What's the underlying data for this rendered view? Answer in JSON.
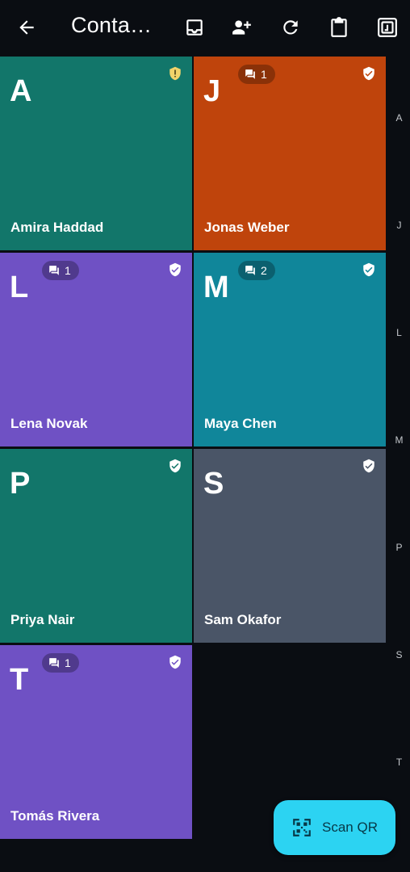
{
  "appbar": {
    "title": "Conta…",
    "actions": [
      "back-arrow-icon",
      "inbox-icon",
      "add-contact-icon",
      "refresh-icon",
      "clipboard-icon",
      "qr-frame-icon"
    ]
  },
  "contacts": [
    {
      "initial": "A",
      "name": "Amira Haddad",
      "color": "#12766a",
      "verified": "warning",
      "badge": null
    },
    {
      "initial": "J",
      "name": "Jonas Weber",
      "color": "#bf440c",
      "verified": "verified",
      "badge": "1"
    },
    {
      "initial": "L",
      "name": "Lena Novak",
      "color": "#6f51c4",
      "verified": "verified",
      "badge": "1"
    },
    {
      "initial": "M",
      "name": "Maya Chen",
      "color": "#10869a",
      "verified": "verified",
      "badge": "2"
    },
    {
      "initial": "P",
      "name": "Priya Nair",
      "color": "#12766a",
      "verified": "verified",
      "badge": null
    },
    {
      "initial": "S",
      "name": "Sam Okafor",
      "color": "#4a5567",
      "verified": "verified",
      "badge": null
    },
    {
      "initial": "T",
      "name": "Tomás Rivera",
      "color": "#6f51c4",
      "verified": "verified",
      "badge": "1"
    }
  ],
  "index": [
    "A",
    "J",
    "L",
    "M",
    "P",
    "S",
    "T"
  ],
  "fab": {
    "label": "Scan QR",
    "icon": "qr-scan-icon"
  },
  "colors": {
    "background": "#0a0d12",
    "fab": "#2cd3f2",
    "warning_shield": "#f0d36a"
  }
}
